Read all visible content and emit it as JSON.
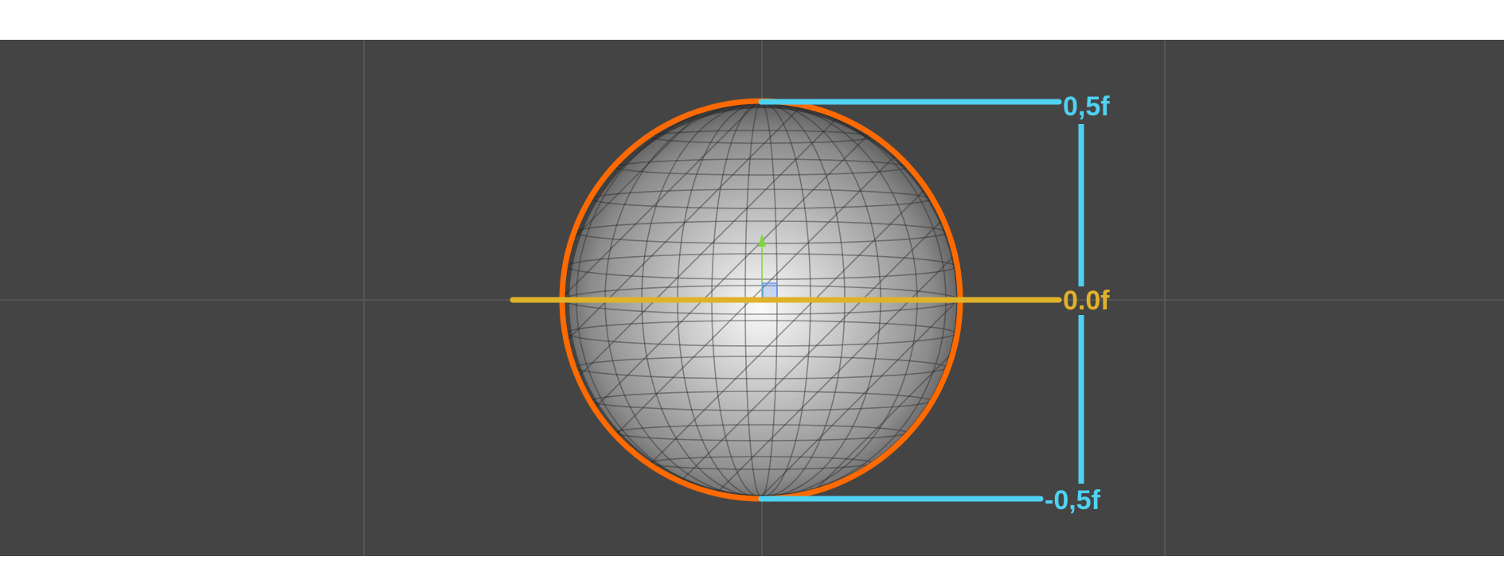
{
  "viewport": {
    "background": "#444444",
    "grid_color": "#555555"
  },
  "annotations": {
    "top_label": "0,5f",
    "center_label": "0.0f",
    "bottom_label": "-0,5f"
  },
  "colors": {
    "outline": "#ff6a00",
    "dimension": "#4fd2f2",
    "center_line": "#e0b22a",
    "axis_y": "#7cd63a",
    "axis_x": "#4f8cff",
    "page_background": "#ffffff"
  },
  "icons": {
    "gizmo": "transform-gizmo-icon"
  }
}
